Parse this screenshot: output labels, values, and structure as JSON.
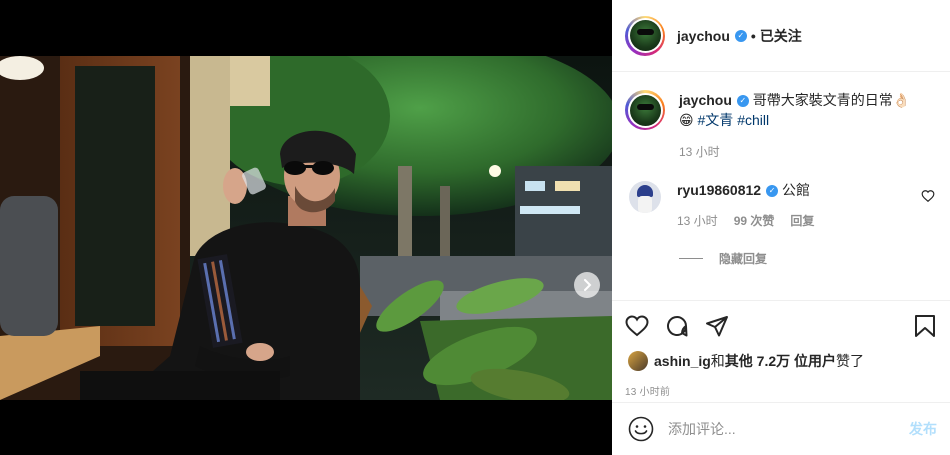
{
  "post": {
    "author": "jaychou",
    "follow_status": "已关注",
    "separator": "•"
  },
  "caption": {
    "username": "jaychou",
    "text": " 哥帶大家裝文青的日常👌🏻",
    "emoji": "😁",
    "hashtags": [
      "#文青",
      "#chill"
    ],
    "time": "13 小时"
  },
  "comments": [
    {
      "username": "ryu19860812",
      "text": " 公館",
      "time": "13 小时",
      "likes": "99 次赞",
      "reply_label": "回复"
    }
  ],
  "hide_replies_label": "隐藏回复",
  "likes": {
    "first_liker": "ashin_ig",
    "connector": " 和 ",
    "others": "其他 7.2万 位用户",
    "suffix": " 赞了"
  },
  "post_time": "13 小时前",
  "add_comment": {
    "placeholder": "添加评论...",
    "post_label": "发布"
  },
  "carousel": {
    "slide_count": 4,
    "active_index": 0
  },
  "icons": {
    "verified": "verified-badge-icon",
    "like": "heart-icon",
    "comment": "comment-bubble-icon",
    "share": "paper-plane-icon",
    "save": "bookmark-icon",
    "emoji": "smiley-icon",
    "next": "chevron-right-icon"
  },
  "colors": {
    "accent": "#3897f0",
    "hashtag": "#00376b",
    "muted": "#8e8e8e",
    "post_disabled": "#b2dffc"
  }
}
